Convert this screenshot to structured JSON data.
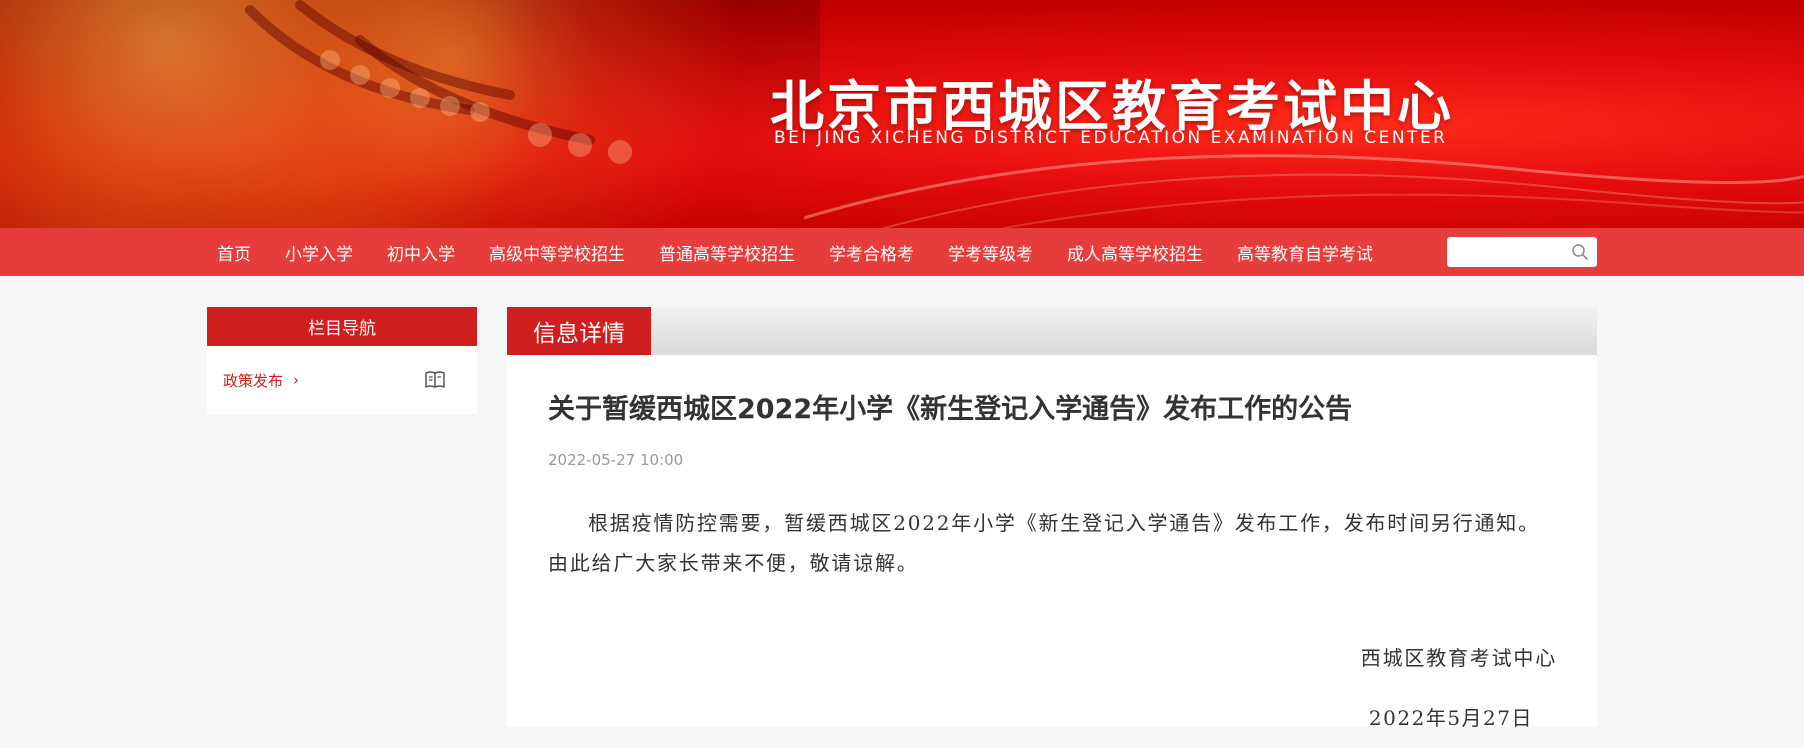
{
  "header": {
    "title": "北京市西城区教育考试中心",
    "subtitle": "BEI JING XICHENG DISTRICT EDUCATION EXAMINATION  CENTER"
  },
  "nav": {
    "items": [
      {
        "label": "首页"
      },
      {
        "label": "小学入学"
      },
      {
        "label": "初中入学"
      },
      {
        "label": "高级中等学校招生"
      },
      {
        "label": "普通高等学校招生"
      },
      {
        "label": "学考合格考"
      },
      {
        "label": "学考等级考"
      },
      {
        "label": "成人高等学校招生"
      },
      {
        "label": "高等教育自学考试"
      }
    ],
    "search": {
      "placeholder": "",
      "value": ""
    }
  },
  "sidebar": {
    "header": "栏目导航",
    "items": [
      {
        "label": "政策发布"
      }
    ]
  },
  "main": {
    "tab_label": "信息详情",
    "article": {
      "title": "关于暂缓西城区2022年小学《新生登记入学通告》发布工作的公告",
      "date": "2022-05-27 10:00",
      "body": "根据疫情防控需要，暂缓西城区2022年小学《新生登记入学通告》发布工作，发布时间另行通知。由此给广大家长带来不便，敬请谅解。",
      "signature": "西城区教育考试中心",
      "signature_date": "2022年5月27日"
    }
  },
  "colors": {
    "brand_red": "#cf1f1f",
    "nav_red": "#e63c3c",
    "banner_red": "#e50d0d"
  }
}
